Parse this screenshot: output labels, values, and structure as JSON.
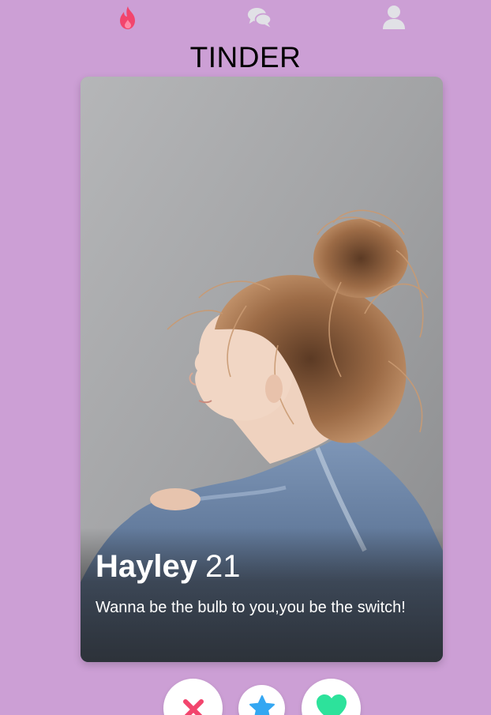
{
  "nav": {
    "items": [
      {
        "icon": "flame-icon",
        "color": "#f2456d"
      },
      {
        "icon": "chat-bubbles-icon",
        "color": "#e1e1e6"
      },
      {
        "icon": "user-icon",
        "color": "#e1e1e6"
      }
    ]
  },
  "header": {
    "title": "TINDER"
  },
  "card": {
    "name": "Hayley",
    "age": "21",
    "bio": "Wanna be the bulb to you,you be the switch!"
  },
  "actions": [
    {
      "icon": "close-icon",
      "color": "#f2456d"
    },
    {
      "icon": "star-icon",
      "color": "#34a7f2"
    },
    {
      "icon": "heart-icon",
      "color": "#2de29b"
    }
  ],
  "colors": {
    "background": "#cc9fd5",
    "card_text": "#ffffff"
  }
}
